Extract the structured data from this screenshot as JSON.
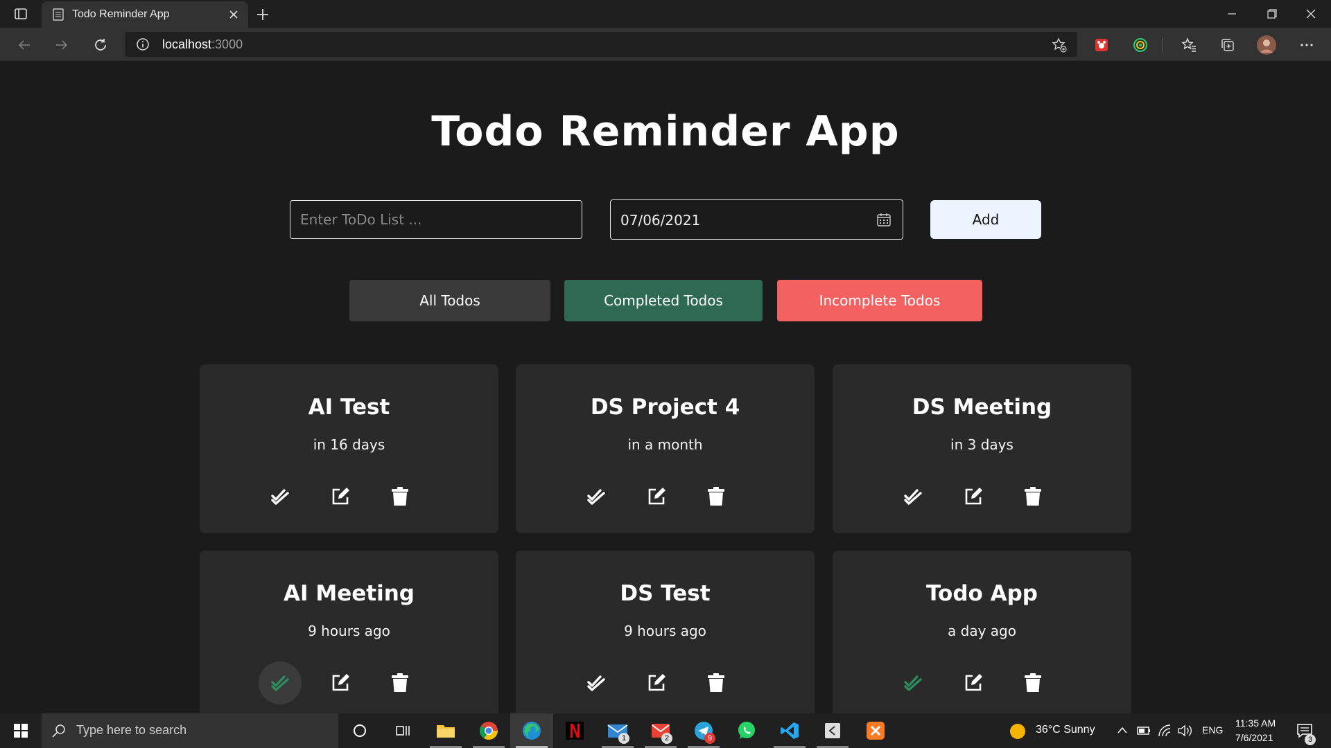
{
  "browser": {
    "tab_title": "Todo Reminder App",
    "url_host": "localhost",
    "url_port": ":3000"
  },
  "app": {
    "title": "Todo Reminder App",
    "todo_placeholder": "Enter ToDo List ...",
    "date_value": "07/06/2021",
    "add_label": "Add",
    "filters": {
      "all": "All Todos",
      "completed": "Completed Todos",
      "incomplete": "Incomplete Todos"
    },
    "colors": {
      "completed": "#2e6a52",
      "incomplete": "#f36161",
      "check_done": "#2e8b5f"
    },
    "todos": [
      {
        "title": "AI Test",
        "due": "in 16 days",
        "completed": false
      },
      {
        "title": "DS Project 4",
        "due": "in a month",
        "completed": false
      },
      {
        "title": "DS Meeting",
        "due": "in 3 days",
        "completed": false
      },
      {
        "title": "AI Meeting",
        "due": "9 hours ago",
        "completed": true
      },
      {
        "title": "DS Test",
        "due": "9 hours ago",
        "completed": false
      },
      {
        "title": "Todo App",
        "due": "a day ago",
        "completed": true
      }
    ]
  },
  "taskbar": {
    "search_placeholder": "Type here to search",
    "weather": "36°C  Sunny",
    "lang": "ENG",
    "time": "11:35 AM",
    "date": "7/6/2021",
    "notifications": "3",
    "badges": {
      "mail": "1",
      "gmail": "2",
      "telegram": "9"
    }
  }
}
